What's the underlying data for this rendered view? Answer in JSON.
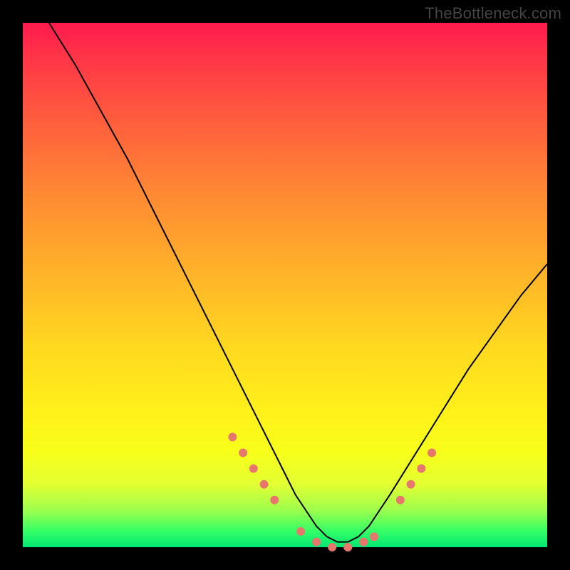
{
  "watermark": "TheBottleneck.com",
  "chart_data": {
    "type": "line",
    "title": "",
    "xlabel": "",
    "ylabel": "",
    "xlim": [
      0,
      100
    ],
    "ylim": [
      0,
      100
    ],
    "series": [
      {
        "name": "bottleneck-curve",
        "x": [
          5,
          10,
          15,
          20,
          25,
          30,
          35,
          40,
          45,
          50,
          52,
          54,
          56,
          58,
          60,
          62,
          64,
          66,
          68,
          70,
          75,
          80,
          85,
          90,
          95,
          100
        ],
        "values": [
          100,
          92,
          83,
          74,
          64,
          54,
          44,
          34,
          24,
          14,
          10,
          7,
          4,
          2,
          1,
          1,
          2,
          4,
          7,
          10,
          18,
          26,
          34,
          41,
          48,
          54
        ]
      }
    ],
    "markers": {
      "name": "highlight-points",
      "x": [
        40,
        42,
        44,
        46,
        48,
        53,
        56,
        59,
        62,
        65,
        67,
        72,
        74,
        76,
        78
      ],
      "values": [
        21,
        18,
        15,
        12,
        9,
        3,
        1,
        0,
        0,
        1,
        2,
        9,
        12,
        15,
        18
      ],
      "color": "#e7766c",
      "size": 12
    },
    "background_gradient": [
      "#ff1a4d",
      "#ffd91f",
      "#00e673"
    ]
  }
}
